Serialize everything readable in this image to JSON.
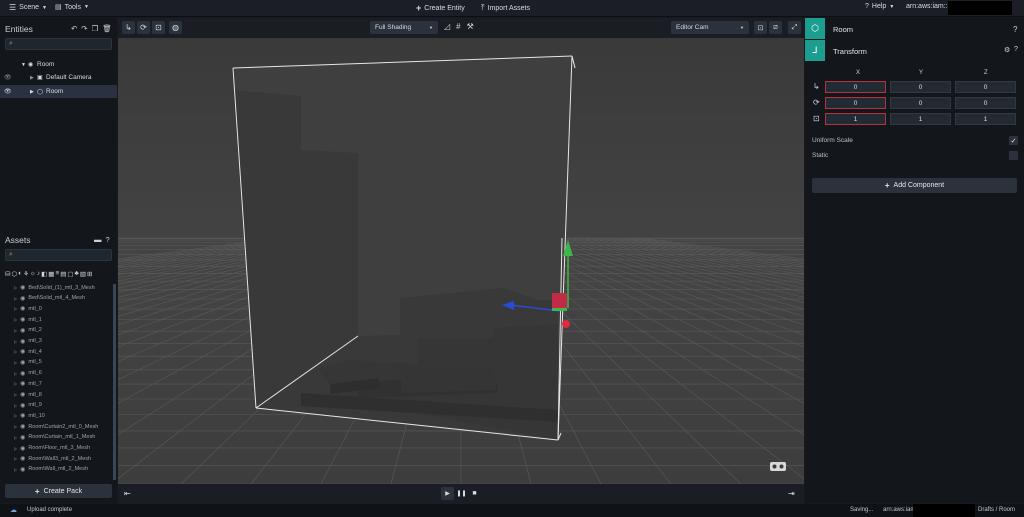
{
  "menu": {
    "scene_label": "Scene",
    "tools_label": "Tools",
    "create_entity_label": "Create Entity",
    "import_assets_label": "Import Assets",
    "help_label": "Help",
    "account_prefix": "arn:aws:iam::"
  },
  "entities": {
    "title": "Entities",
    "items": [
      {
        "label": "Room",
        "level": 0
      },
      {
        "label": "Default Camera",
        "level": 1
      },
      {
        "label": "Room",
        "level": 1,
        "selected": true
      }
    ]
  },
  "assets": {
    "title": "Assets",
    "items": [
      "Bed\\Solid_(1)_mtl_3_Mesh",
      "Bed\\Solid_mtl_4_Mesh",
      "mtl_0",
      "mtl_1",
      "mtl_2",
      "mtl_3",
      "mtl_4",
      "mtl_5",
      "mtl_6",
      "mtl_7",
      "mtl_8",
      "mtl_9",
      "mtl_10",
      "Room\\Curtain2_mtl_0_Mesh",
      "Room\\Curtain_mtl_1_Mesh",
      "Room\\Floor_mtl_3_Mesh",
      "Room\\Wall3_mtl_2_Mesh",
      "Room\\Wall_mtl_2_Mesh"
    ],
    "create_pack_label": "Create Pack"
  },
  "viewport_toolbar": {
    "shading_value": "Full Shading",
    "camera_value": "Editor Cam"
  },
  "inspector": {
    "entity_name": "Room",
    "component_name": "Transform",
    "axes": [
      "X",
      "Y",
      "Z"
    ],
    "position": [
      "0",
      "0",
      "0"
    ],
    "rotation": [
      "0",
      "0",
      "0"
    ],
    "scale": [
      "1",
      "1",
      "1"
    ],
    "uniform_scale_label": "Uniform Scale",
    "uniform_scale_checked": true,
    "static_label": "Static",
    "static_checked": false,
    "add_component_label": "Add Component"
  },
  "status": {
    "left_text": "Upload complete",
    "saving_text": "Saving...",
    "account_prefix": "arn:aws:iam",
    "breadcrumb": "Drafts / Room"
  },
  "colors": {
    "accent_teal": "#1b9e8f",
    "x_axis_red": "#b3343f",
    "gizmo_green": "#3fb54a",
    "gizmo_blue": "#2c4ad8",
    "gizmo_red": "#e0293e"
  }
}
